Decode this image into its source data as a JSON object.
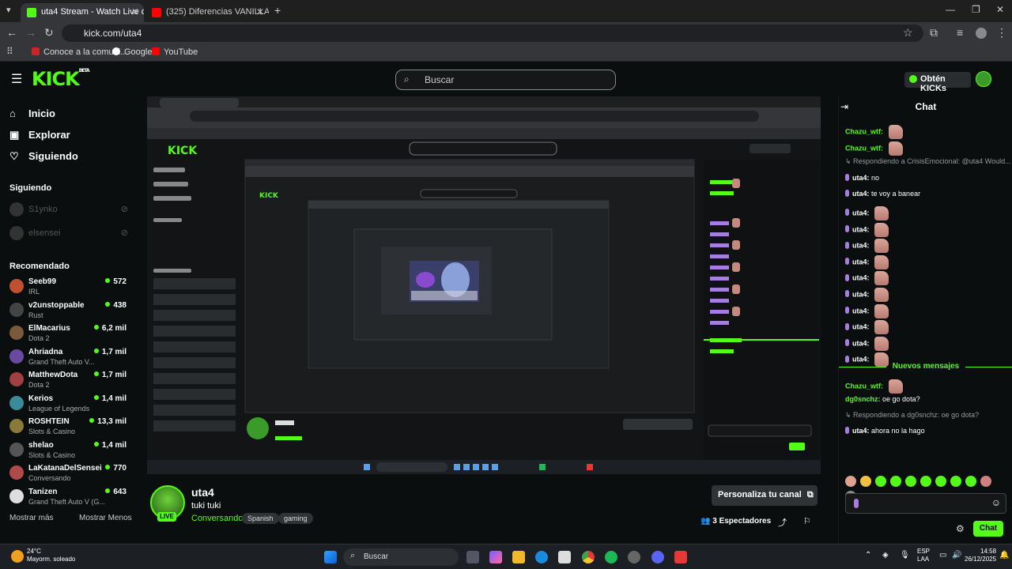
{
  "browser": {
    "tabs": [
      {
        "title": "uta4 Stream - Watch Live on Ki",
        "active": true,
        "favicon_color": "#53fc18"
      },
      {
        "title": "(325) Diferencias VANILLA vs 2(",
        "active": false,
        "favicon_color": "#ff0000"
      }
    ],
    "url": "kick.com/uta4",
    "bookmarks": [
      "Conoce a la comuni...",
      "Google",
      "YouTube"
    ]
  },
  "header": {
    "logo": "KICK",
    "logo_badge": "BETA",
    "search_placeholder": "Buscar",
    "get_kicks": "Obtén KICKs"
  },
  "sidebar": {
    "nav": [
      {
        "label": "Inicio",
        "icon": "home-icon"
      },
      {
        "label": "Explorar",
        "icon": "compass-icon"
      },
      {
        "label": "Siguiendo",
        "icon": "heart-icon"
      }
    ],
    "following_title": "Siguiendo",
    "following": [
      "S1ynko",
      "elsensei"
    ],
    "recommended_title": "Recomendado",
    "recommended": [
      {
        "name": "Seeb99",
        "category": "IRL",
        "viewers": "572",
        "color": "#c05030"
      },
      {
        "name": "v2unstoppable",
        "category": "Rust",
        "viewers": "438",
        "color": "#444"
      },
      {
        "name": "ElMacarius",
        "category": "Dota 2",
        "viewers": "6,2 mil",
        "color": "#7a5a3a"
      },
      {
        "name": "Ahriadna",
        "category": "Grand Theft Auto V...",
        "viewers": "1,7 mil",
        "color": "#6a4aa0"
      },
      {
        "name": "MatthewDota",
        "category": "Dota 2",
        "viewers": "1,7 mil",
        "color": "#a04040"
      },
      {
        "name": "Kerios",
        "category": "League of Legends",
        "viewers": "1,4 mil",
        "color": "#3a8a9a"
      },
      {
        "name": "ROSHTEIN",
        "category": "Slots & Casino",
        "viewers": "13,3 mil",
        "color": "#8a7a3a"
      },
      {
        "name": "shelao",
        "category": "Slots & Casino",
        "viewers": "1,4 mil",
        "color": "#555"
      },
      {
        "name": "LaKatanaDelSensei",
        "category": "Conversando",
        "viewers": "770",
        "color": "#b04a4a"
      },
      {
        "name": "Tanizen",
        "category": "Grand Theft Auto V (G...",
        "viewers": "643",
        "color": "#ddd"
      }
    ],
    "show_more": "Mostrar más",
    "show_less": "Mostrar Menos"
  },
  "stream": {
    "name": "uta4",
    "title": "tuki tuki",
    "category": "Conversando",
    "tags": [
      "Spanish",
      "gaming"
    ],
    "live": "LIVE",
    "customize": "Personaliza tu canal",
    "viewers_count": "3",
    "viewers_label": "Espectadores"
  },
  "chat": {
    "title": "Chat",
    "messages": [
      {
        "kind": "msg",
        "user": "Chazu_wtf:",
        "text": "",
        "thumb": true,
        "mic": false
      },
      {
        "kind": "msg",
        "user": "Chazu_wtf:",
        "text": "",
        "thumb": true,
        "mic": false
      },
      {
        "kind": "reply",
        "text": "Respondiendo a CrisisEmocional: @uta4 Would..."
      },
      {
        "kind": "msg",
        "user": "uta4:",
        "text": "no",
        "thumb": false,
        "mic": true
      },
      {
        "kind": "msg",
        "user": "uta4:",
        "text": "te voy a banear",
        "thumb": false,
        "mic": true
      },
      {
        "kind": "msg",
        "user": "uta4:",
        "text": "",
        "thumb": true,
        "mic": true
      },
      {
        "kind": "msg",
        "user": "uta4:",
        "text": "",
        "thumb": true,
        "mic": true
      },
      {
        "kind": "msg",
        "user": "uta4:",
        "text": "",
        "thumb": true,
        "mic": true
      },
      {
        "kind": "msg",
        "user": "uta4:",
        "text": "",
        "thumb": true,
        "mic": true
      },
      {
        "kind": "msg",
        "user": "uta4:",
        "text": "",
        "thumb": true,
        "mic": true
      },
      {
        "kind": "msg",
        "user": "uta4:",
        "text": "",
        "thumb": true,
        "mic": true
      },
      {
        "kind": "msg",
        "user": "uta4:",
        "text": "",
        "thumb": true,
        "mic": true
      },
      {
        "kind": "msg",
        "user": "uta4:",
        "text": "",
        "thumb": true,
        "mic": true
      },
      {
        "kind": "msg",
        "user": "uta4:",
        "text": "",
        "thumb": true,
        "mic": true
      },
      {
        "kind": "msg",
        "user": "uta4:",
        "text": "",
        "thumb": true,
        "mic": true
      }
    ],
    "new_messages": "Nuevos mensajes",
    "after": [
      {
        "kind": "msg",
        "user": "Chazu_wtf:",
        "text": "",
        "thumb": true,
        "mic": false
      },
      {
        "kind": "msg",
        "user": "dg0snchz:",
        "text": "oe go dota?",
        "thumb": false,
        "mic": false
      },
      {
        "kind": "reply",
        "text": "Respondiendo a dg0snchz: oe go dota?"
      },
      {
        "kind": "msg",
        "user": "uta4:",
        "text": "ahora no la hago",
        "thumb": false,
        "mic": true
      }
    ],
    "send": "Chat"
  },
  "taskbar": {
    "weather_temp": "24°C",
    "weather_desc": "Mayorm. soleado",
    "search": "Buscar",
    "lang": "ESP",
    "lang2": "LAA",
    "time": "14:58",
    "date": "26/12/2025"
  }
}
